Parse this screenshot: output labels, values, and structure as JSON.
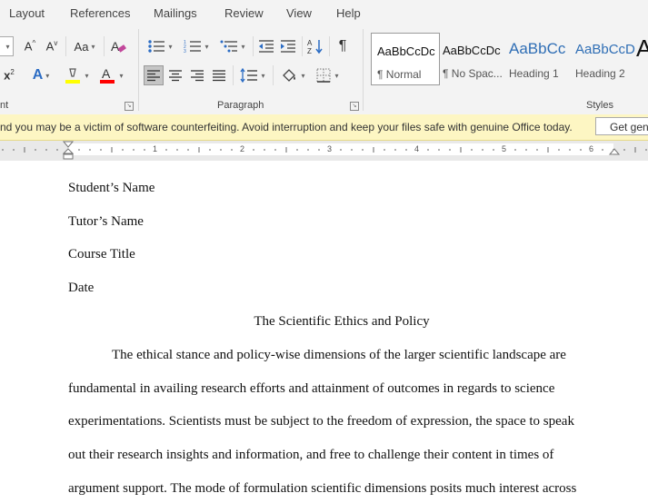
{
  "tabs": [
    "Layout",
    "References",
    "Mailings",
    "Review",
    "View",
    "Help"
  ],
  "ribbon": {
    "font_group_label": "nt",
    "paragraph_group_label": "Paragraph",
    "styles_group_label": "Styles",
    "font_case_label": "Aa",
    "font_grow_label": "A",
    "font_shrink_label": "A",
    "text_effects_label": "A",
    "font_color_label": "A",
    "superscript_label": "x",
    "superscript_mark": "2",
    "highlight_color": "#ffff00",
    "font_color": "#ff0000",
    "styles": [
      {
        "sample": "AaBbCcDc",
        "name": "¶ Normal"
      },
      {
        "sample": "AaBbCcDc",
        "name": "¶ No Spac..."
      },
      {
        "sample": "AaBbCc",
        "name": "Heading 1"
      },
      {
        "sample": "AaBbCcD",
        "name": "Heading 2"
      },
      {
        "sample": "A",
        "name": ""
      }
    ]
  },
  "notification": {
    "message": "nd you may be a victim of software counterfeiting. Avoid interruption and keep your files safe with genuine Office today.",
    "button_label": "Get genu"
  },
  "ruler": {
    "numbers": [
      "1",
      "2",
      "3",
      "4",
      "5",
      "6"
    ]
  },
  "document": {
    "header_lines": [
      "Student’s Name",
      "Tutor’s Name",
      "Course Title",
      "Date"
    ],
    "title": "The Scientific Ethics and Policy",
    "body_lines": [
      "The ethical stance and policy-wise dimensions of the larger scientific landscape are",
      "fundamental in availing research efforts and attainment of outcomes in regards to science",
      "experimentations. Scientists must be subject to the freedom of expression, the space to speak",
      "out their research insights and information, and free to challenge their content in times of",
      "argument support. The mode of formulation scientific dimensions posits much interest across"
    ]
  }
}
